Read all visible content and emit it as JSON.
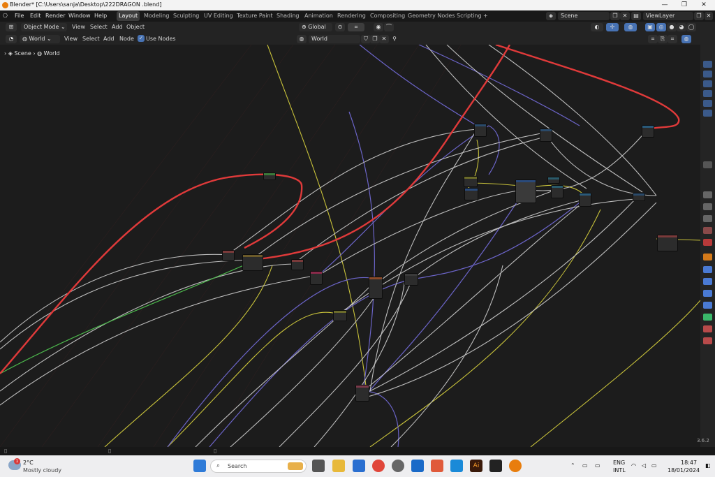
{
  "window": {
    "title": "Blender* [C:\\Users\\sanja\\Desktop\\222DRAGON .blend]",
    "minimize": "—",
    "maximize": "❐",
    "close": "✕"
  },
  "topbar": {
    "menus": [
      "File",
      "Edit",
      "Render",
      "Window",
      "Help"
    ],
    "workspaces": [
      "Layout",
      "Modeling",
      "Sculpting",
      "UV Editing",
      "Texture Paint",
      "Shading",
      "Animation",
      "Rendering",
      "Compositing",
      "Geometry Nodes",
      "Scripting"
    ],
    "active_workspace": "Layout",
    "add_workspace": "+",
    "scene": "Scene",
    "view_layer": "ViewLayer"
  },
  "viewport_header": {
    "mode": "Object Mode",
    "menus": [
      "View",
      "Select",
      "Add",
      "Object"
    ],
    "transform_orientation": "Global"
  },
  "node_header": {
    "shader_type": "World",
    "menus": [
      "View",
      "Select",
      "Add",
      "Node"
    ],
    "use_nodes_label": "Use Nodes",
    "use_nodes_checked": true,
    "datablock": "World"
  },
  "breadcrumb": [
    "Scene",
    "World"
  ],
  "status": {
    "version": "3.6.2"
  },
  "taskbar": {
    "weather_temp": "2°C",
    "weather_desc": "Mostly cloudy",
    "weather_badge": "1",
    "search_placeholder": "Search",
    "language_top": "ENG",
    "language_bottom": "INTL",
    "time": "18:47",
    "date": "18/01/2024"
  },
  "colors": {
    "link_red": "#e03a3a",
    "link_white": "#d9d9d9",
    "link_purple": "#6b64c8",
    "link_yellow": "#c8c23a",
    "link_green": "#4cb84c",
    "accent_blue": "#4772b3"
  }
}
